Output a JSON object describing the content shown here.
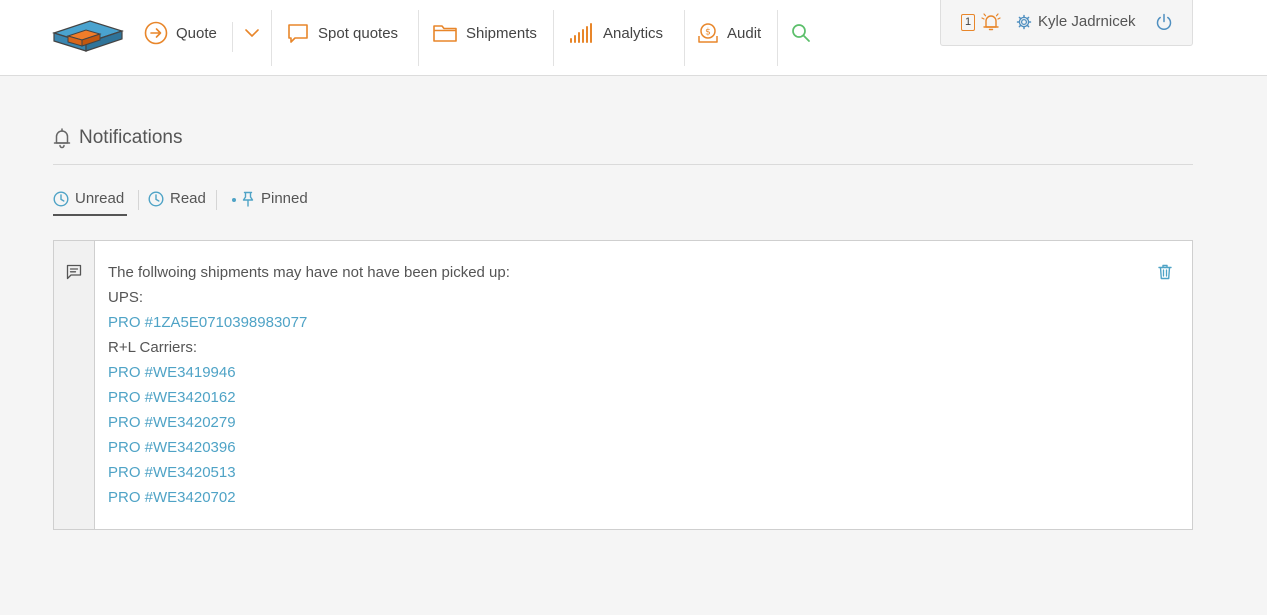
{
  "nav": {
    "quote_label": "Quote",
    "spot_quotes_label": "Spot quotes",
    "shipments_label": "Shipments",
    "analytics_label": "Analytics",
    "audit_label": "Audit"
  },
  "user": {
    "alert_count": "1",
    "name": "Kyle Jadrnicek"
  },
  "page": {
    "title": "Notifications"
  },
  "tabs": [
    {
      "label": "Unread",
      "active": true
    },
    {
      "label": "Read",
      "active": false
    },
    {
      "label": "Pinned",
      "active": false
    }
  ],
  "notification": {
    "intro": "The follwoing shipments may have not have been picked up:",
    "groups": [
      {
        "carrier": "UPS:",
        "pros": [
          "PRO #1ZA5E0710398983077"
        ]
      },
      {
        "carrier": "R+L Carriers:",
        "pros": [
          "PRO #WE3419946",
          "PRO #WE3420162",
          "PRO #WE3420279",
          "PRO #WE3420396",
          "PRO #WE3420513",
          "PRO #WE3420702"
        ]
      }
    ]
  },
  "colors": {
    "accent_orange": "#e8862a",
    "link_blue": "#4fa3c6",
    "search_green": "#5cbf6b",
    "icon_blue": "#4f8fc0"
  }
}
